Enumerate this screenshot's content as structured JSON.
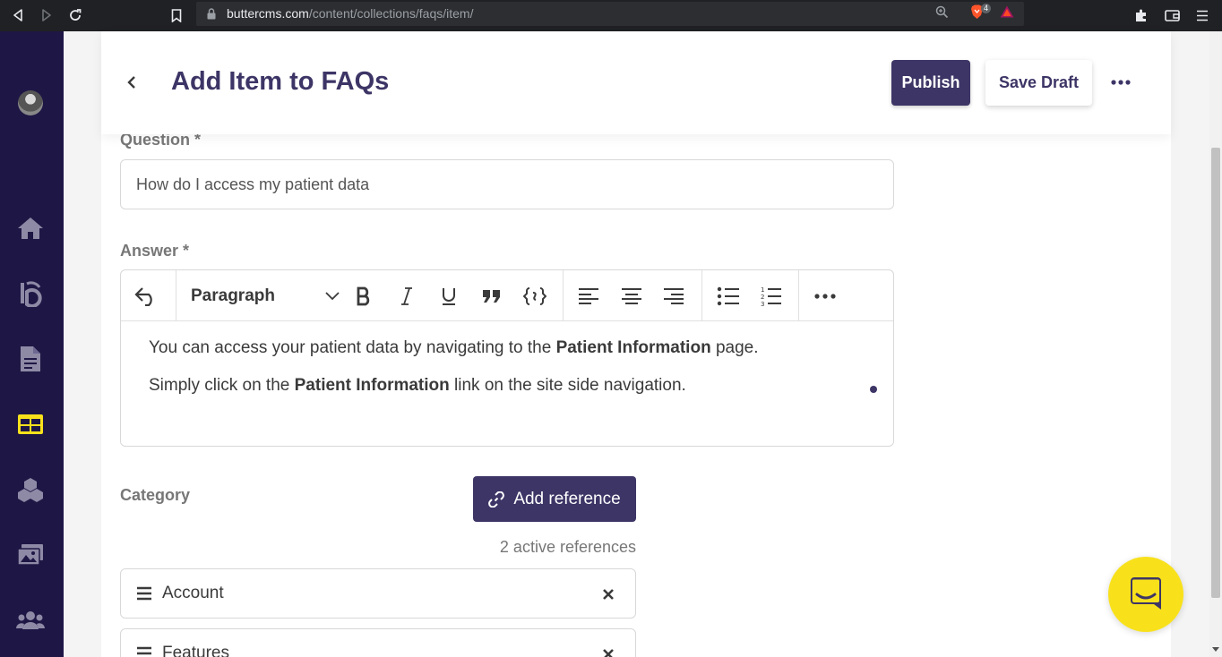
{
  "browser": {
    "url_domain": "buttercms.com",
    "url_path": "/content/collections/faqs/item/",
    "brave_badge_count": "4"
  },
  "sidebar": {
    "items": [
      {
        "icon": "home-icon"
      },
      {
        "icon": "blog-icon"
      },
      {
        "icon": "pages-icon"
      },
      {
        "icon": "collections-icon",
        "active": true,
        "color": "#f8e11b"
      },
      {
        "icon": "components-icon"
      },
      {
        "icon": "media-icon"
      },
      {
        "icon": "users-icon"
      }
    ]
  },
  "header": {
    "title": "Add Item to FAQs",
    "publish_label": "Publish",
    "save_draft_label": "Save Draft"
  },
  "question": {
    "label": "Question *",
    "value": "How do I access my patient data"
  },
  "answer": {
    "label": "Answer *",
    "block_format": "Paragraph",
    "line1_before": "You can access your patient data by navigating to the ",
    "line1_bold": "Patient Information",
    "line1_after": " page.",
    "line2_before": "Simply click on the ",
    "line2_bold": "Patient Information",
    "line2_after": " link on the site side navigation."
  },
  "category": {
    "label": "Category",
    "add_reference_label": "Add reference",
    "active_references_text": "2 active references",
    "references": [
      {
        "label": "Account"
      },
      {
        "label": "Features"
      }
    ]
  },
  "colors": {
    "brand": "#3d3566",
    "sidebar_bg": "#1e1745",
    "chat_bubble": "#f8e11b"
  }
}
